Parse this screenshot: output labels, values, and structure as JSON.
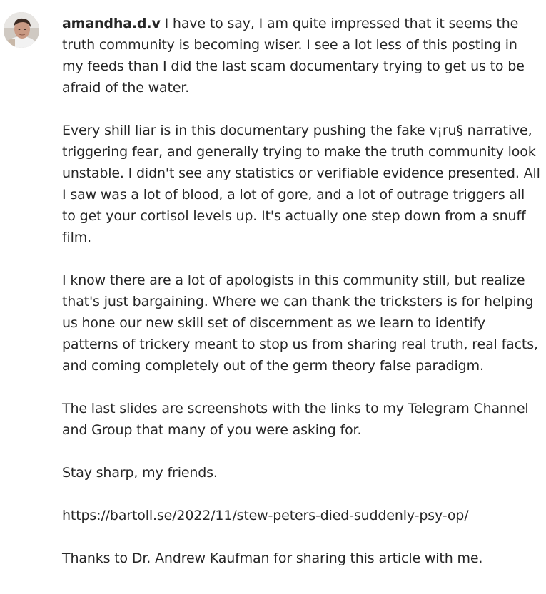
{
  "comment": {
    "username": "amandha.d.v",
    "avatar_icon": "user-avatar-photo",
    "paragraphs": {
      "p1": "I have to say, I am quite impressed that it seems the truth community is becoming wiser. I see a lot less of this posting in my feeds than I did the last scam documentary trying to get us to be afraid of the water.",
      "p2": "Every shill liar is in this documentary pushing the fake v¡ru§ narrative, triggering fear, and generally trying to make the truth community look unstable. I didn't see any statistics or verifiable evidence presented. All I saw was a lot of blood, a lot of gore, and a lot of outrage triggers all to get your cortisol levels up. It's actually one step down from a snuff film.",
      "p3": "I know there are a lot of apologists in this community still, but realize that's just bargaining. Where we can thank the tricksters is for helping us hone our new skill set of discernment as we learn to identify patterns of trickery meant to stop us from sharing real truth, real facts, and coming completely out of the germ theory false paradigm.",
      "p4": "The last slides are screenshots with the links to my Telegram Channel and Group that many of you were asking for.",
      "p5": "Stay sharp, my friends.",
      "p6_link": "https://bartoll.se/2022/11/stew-peters-died-suddenly-psy-op/",
      "p7": "Thanks to Dr. Andrew Kaufman for sharing this article with me."
    }
  }
}
